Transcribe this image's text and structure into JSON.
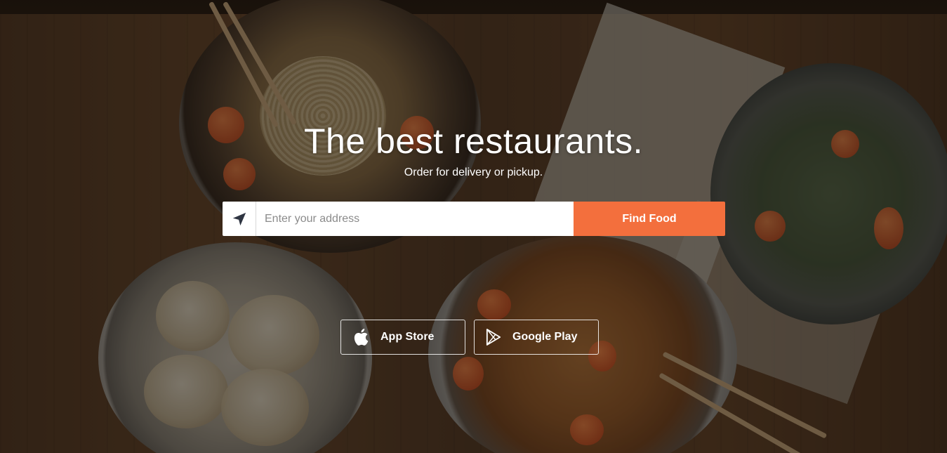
{
  "hero": {
    "headline": "The best restaurants.",
    "subheadline": "Order for delivery or pickup."
  },
  "search": {
    "placeholder": "Enter your address",
    "value": "",
    "location_icon": "navigation-arrow-icon",
    "submit_label": "Find Food"
  },
  "apps": {
    "app_store_label": "App Store",
    "app_store_icon": "apple-icon",
    "google_play_label": "Google Play",
    "google_play_icon": "play-store-icon"
  },
  "colors": {
    "accent": "#f36f3d",
    "text": "#ffffff"
  }
}
